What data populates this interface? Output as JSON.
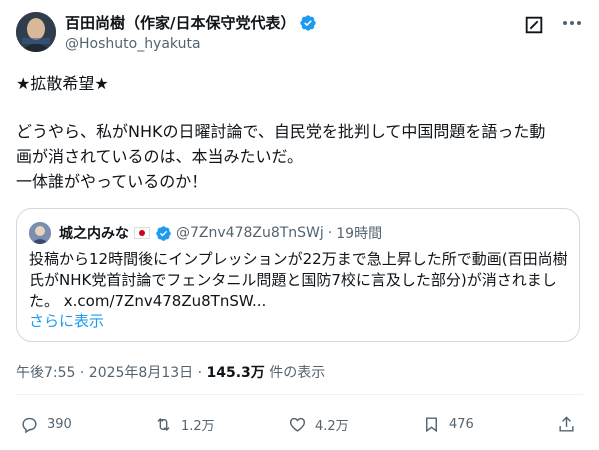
{
  "author": {
    "name": "百田尚樹（作家/日本保守党代表）",
    "handle": "@Hoshuto_hyakuta"
  },
  "tweet": {
    "lines": [
      "★拡散希望★",
      "どうやら、私がNHKの日曜討論で、自民党を批判して中国問題を語った動",
      "画が消されているのは、本当みたいだ。",
      "一体誰がやっているのか！"
    ]
  },
  "quote": {
    "name": "城之内みな",
    "handle": "@7Znv478Zu8TnSWj",
    "separator": "·",
    "time": "19時間",
    "lines": [
      "投稿から12時間後にインプレッションが22万まで急上昇した所で動画(百田尚樹",
      "氏がNHK党首討論でフェンタニル問題と国防7校に言及した部分)が消されまし",
      "た。 x.com/7Znv478Zu8TnSW..."
    ],
    "show_more": "さらに表示"
  },
  "meta": {
    "time": "午後7:55 · 2025年8月13日 · ",
    "views_count": "145.3万",
    "views_label": " 件の表示"
  },
  "actions": {
    "replies": "390",
    "reposts": "1.2万",
    "likes": "4.2万",
    "bookmarks": "476"
  },
  "colors": {
    "accent": "#1d9bf0",
    "secondary_text": "#536471",
    "border": "#cfd9de"
  }
}
